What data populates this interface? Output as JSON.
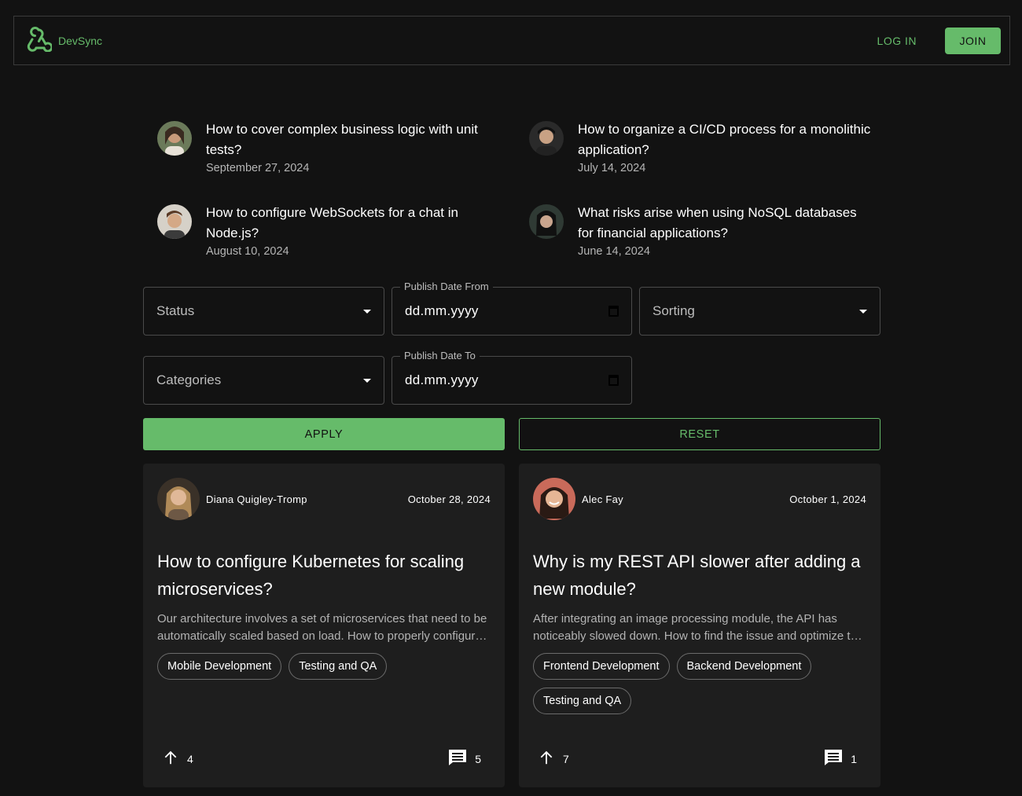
{
  "header": {
    "brand": "DevSync",
    "login_label": "LOG IN",
    "join_label": "JOIN",
    "accent": "#66bb6a"
  },
  "popular": [
    {
      "title": "How to cover complex business logic with unit tests?",
      "date": "September 27, 2024"
    },
    {
      "title": "How to organize a CI/CD process for a monolithic application?",
      "date": "July 14, 2024"
    },
    {
      "title": "How to configure WebSockets for a chat in Node.js?",
      "date": "August 10, 2024"
    },
    {
      "title": "What risks arise when using NoSQL databases for financial applications?",
      "date": "June 14, 2024"
    }
  ],
  "filters": {
    "status_placeholder": "Status",
    "publish_from_label": "Publish Date From",
    "publish_from_value": "dd.mm.yyyy",
    "sorting_placeholder": "Sorting",
    "categories_placeholder": "Categories",
    "publish_to_label": "Publish Date To",
    "publish_to_value": "dd.mm.yyyy",
    "apply_label": "APPLY",
    "reset_label": "RESET"
  },
  "posts": [
    {
      "author": "Diana Quigley-Tromp",
      "date": "October 28, 2024",
      "title": "How to configure Kubernetes for scaling microservices?",
      "excerpt": "Our architecture involves a set of microservices that need to be automatically scaled based on load. How to properly configure Kubernetes for this?",
      "tags": [
        "Mobile Development",
        "Testing and QA"
      ],
      "votes": "4",
      "comments": "5"
    },
    {
      "author": "Alec Fay",
      "date": "October 1, 2024",
      "title": "Why is my REST API slower after adding a new module?",
      "excerpt": "After integrating an image processing module, the API has noticeably slowed down. How to find the issue and optimize the performance?",
      "tags": [
        "Frontend Development",
        "Backend Development",
        "Testing and QA"
      ],
      "votes": "7",
      "comments": "1"
    }
  ]
}
